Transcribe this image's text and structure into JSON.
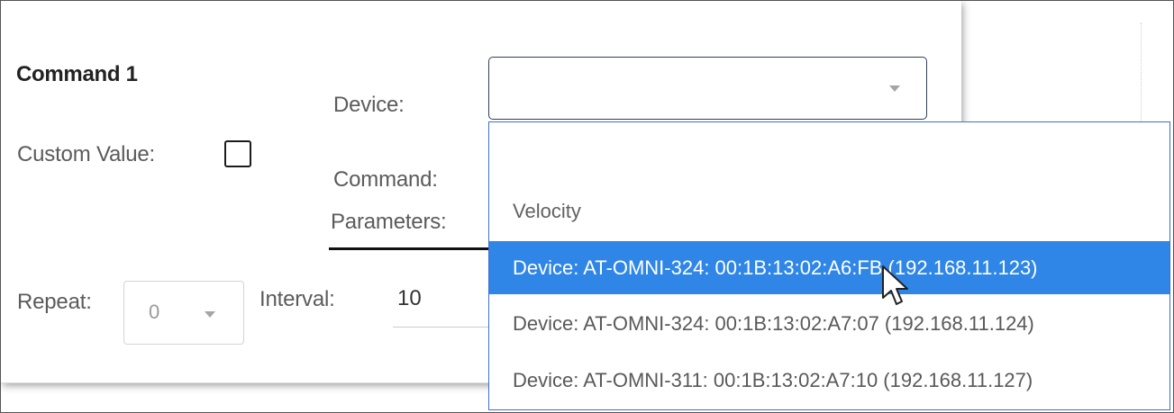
{
  "command": {
    "title": "Command 1",
    "device_label": "Device:",
    "custom_value_label": "Custom Value:",
    "command_label": "Command:",
    "parameters_label": "Parameters:",
    "repeat_label": "Repeat:",
    "repeat_value": "0",
    "interval_label": "Interval:",
    "interval_value": "10",
    "custom_value_checked": false
  },
  "device_select": {
    "selected_value": "",
    "options": [
      {
        "label": ""
      },
      {
        "label": "Velocity",
        "type": "group"
      },
      {
        "label": "Device: AT-OMNI-324: 00:1B:13:02:A6:FB (192.168.11.123)",
        "highlighted": true
      },
      {
        "label": "Device: AT-OMNI-324: 00:1B:13:02:A7:07 (192.168.11.124)"
      },
      {
        "label": "Device: AT-OMNI-311: 00:1B:13:02:A7:10 (192.168.11.127)"
      }
    ]
  },
  "colors": {
    "highlight": "#2f86e6",
    "dropdown_border": "#3f6fd0",
    "select_border": "#2f3f57"
  },
  "icons": {
    "dropdown_caret": "chevron-down-icon",
    "repeat_caret": "chevron-down-icon",
    "cursor": "mouse-pointer-icon"
  }
}
